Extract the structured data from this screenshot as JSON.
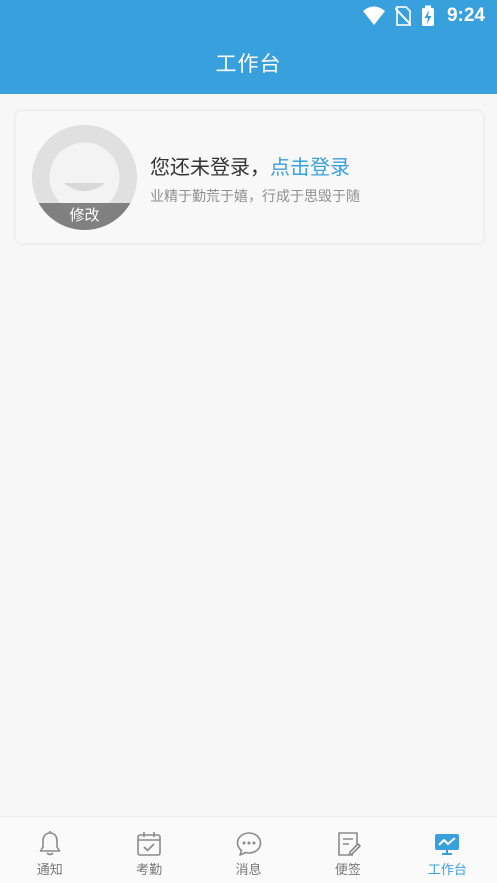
{
  "status_bar": {
    "time": "9:24",
    "icons": [
      "wifi-icon",
      "no-sim-icon",
      "battery-charging-icon"
    ]
  },
  "header": {
    "title": "工作台"
  },
  "profile": {
    "avatar_edit_label": "修改",
    "not_logged_in_text": "您还未登录，",
    "login_link_text": "点击登录",
    "motto": "业精于勤荒于嬉，行成于思毁于随"
  },
  "bottom_nav": {
    "items": [
      {
        "label": "通知",
        "icon": "bell-icon",
        "active": false
      },
      {
        "label": "考勤",
        "icon": "calendar-check-icon",
        "active": false
      },
      {
        "label": "消息",
        "icon": "chat-bubble-icon",
        "active": false
      },
      {
        "label": "便签",
        "icon": "note-edit-icon",
        "active": false
      },
      {
        "label": "工作台",
        "icon": "workbench-icon",
        "active": true
      }
    ]
  },
  "colors": {
    "accent": "#38a0dd",
    "inactive": "#777777",
    "background": "#f7f7f7"
  }
}
